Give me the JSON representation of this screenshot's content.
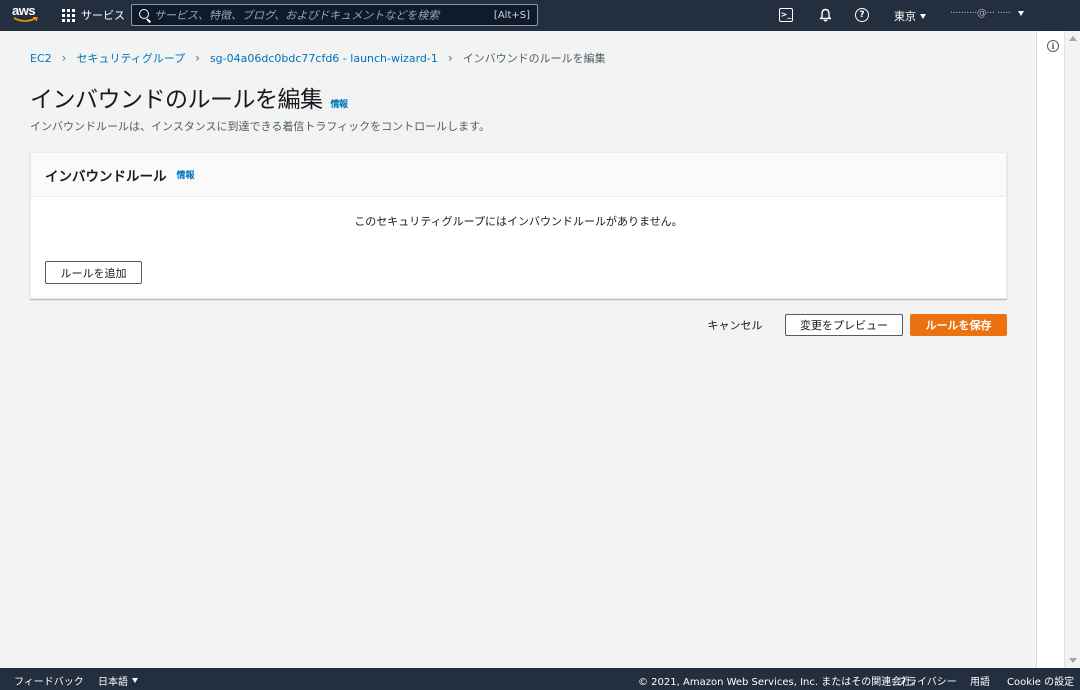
{
  "topnav": {
    "logo_text": "aws",
    "services_label": "サービス",
    "search_placeholder": "サービス、特徴、ブログ、およびドキュメントなどを検索",
    "search_shortcut": "[Alt+S]",
    "region_label": "東京",
    "account_label": "··········@···  ·····",
    "icons": [
      "terminal-icon",
      "bell-icon",
      "help-icon"
    ]
  },
  "breadcrumb": {
    "items": [
      "EC2",
      "セキュリティグループ",
      "sg-04a06dc0bdc77cfd6 - launch-wizard-1"
    ],
    "current": "インバウンドのルールを編集"
  },
  "header": {
    "title": "インバウンドのルールを編集",
    "info_link": "情報",
    "description": "インバウンドルールは、インスタンスに到達できる着信トラフィックをコントロールします。"
  },
  "panel": {
    "title": "インバウンドルール",
    "info_link": "情報",
    "empty_message": "このセキュリティグループにはインバウンドルールがありません。",
    "add_rule_label": "ルールを追加"
  },
  "actions": {
    "cancel_label": "キャンセル",
    "preview_label": "変更をプレビュー",
    "save_label": "ルールを保存"
  },
  "footer": {
    "feedback_label": "フィードバック",
    "language_label": "日本語",
    "copyright": "© 2021, Amazon Web Services, Inc. またはその関連会社。",
    "privacy_label": "プライバシー",
    "terms_label": "用語",
    "cookie_label": "Cookie の設定"
  },
  "colors": {
    "nav_bg": "#232f3e",
    "link": "#0073bb",
    "primary_button": "#ec7211",
    "page_bg": "#f2f3f3"
  }
}
